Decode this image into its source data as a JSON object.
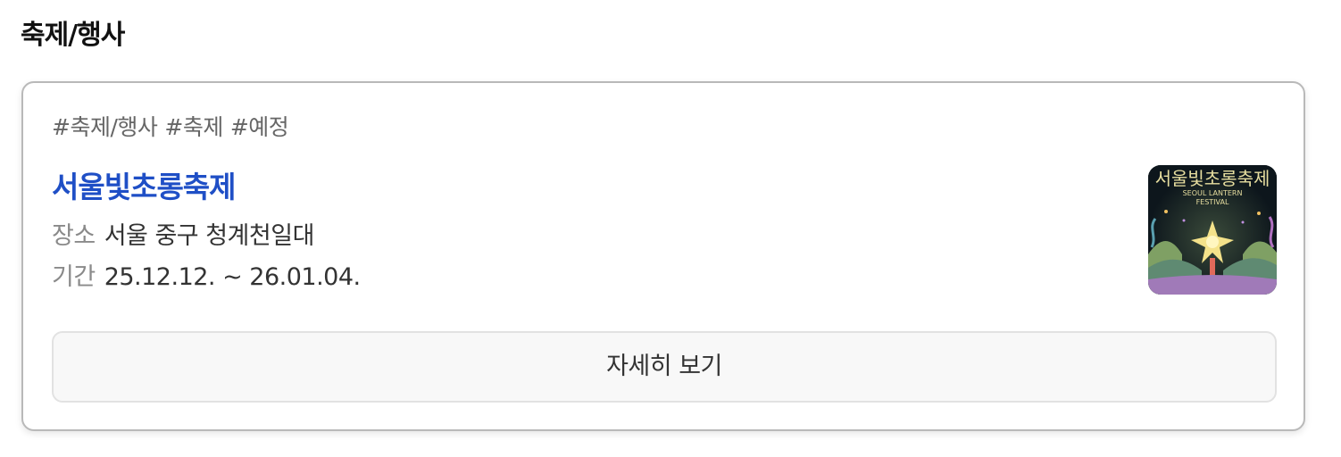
{
  "section": {
    "title": "축제/행사"
  },
  "event": {
    "tags": [
      "#축제/행사",
      "#축제",
      "#예정"
    ],
    "title": "서울빛초롱축제",
    "place_label": "장소",
    "place_value": "서울 중구 청계천일대",
    "period_label": "기간",
    "period_value": "25.12.12. ~ 26.01.04.",
    "poster": {
      "title_text": "서울빛초롱축제",
      "subtitle_line1": "SEOUL LANTERN",
      "subtitle_line2": "FESTIVAL"
    },
    "detail_button_label": "자세히 보기"
  },
  "colors": {
    "accent_title": "#1f4fc6",
    "tag_text": "#666666",
    "label_text": "#8a8a8a",
    "card_border": "#b9b9b9",
    "button_bg": "#f8f8f8"
  }
}
